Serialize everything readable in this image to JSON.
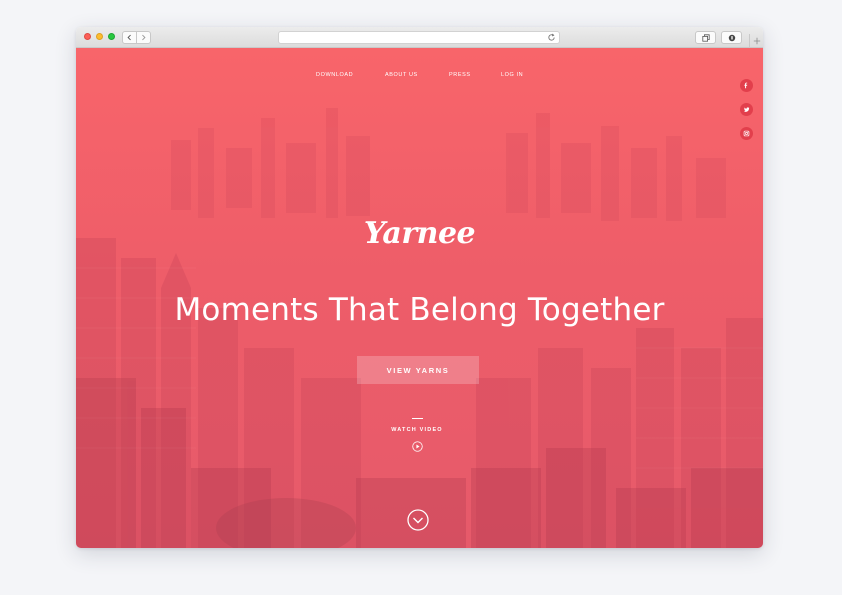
{
  "browser": {
    "url": "",
    "icons": [
      "back-icon",
      "forward-icon",
      "reload-icon",
      "tabs-icon",
      "extension-icon",
      "new-tab-icon"
    ]
  },
  "nav": {
    "items": [
      {
        "label": "DOWNLOAD"
      },
      {
        "label": "ABOUT US"
      },
      {
        "label": "PRESS"
      },
      {
        "label": "LOG IN"
      }
    ]
  },
  "social": [
    "facebook-icon",
    "twitter-icon",
    "instagram-icon"
  ],
  "hero": {
    "logo": "Yarnee",
    "headline": "Moments That Belong Together",
    "cta_label": "VIEW YARNS",
    "watch_label": "WATCH VIDEO"
  },
  "colors": {
    "accent": "#f0606a",
    "social_bg": "#e23f4c",
    "text": "#ffffff"
  }
}
